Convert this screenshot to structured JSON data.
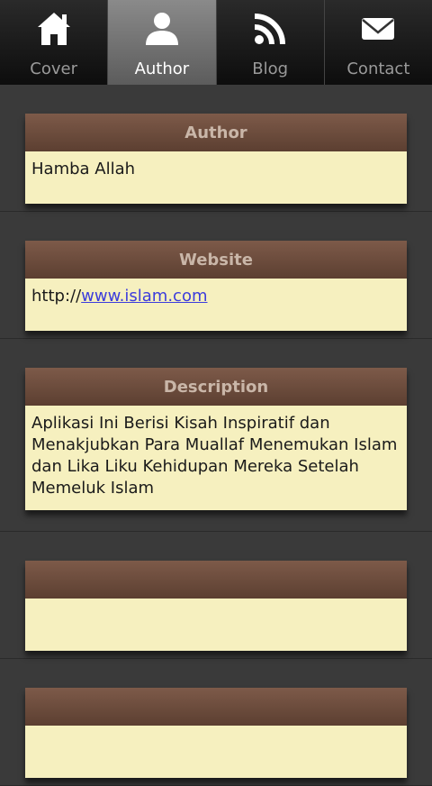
{
  "tabs": [
    {
      "label": "Cover",
      "icon": "home-icon",
      "active": false
    },
    {
      "label": "Author",
      "icon": "person-icon",
      "active": true
    },
    {
      "label": "Blog",
      "icon": "rss-icon",
      "active": false
    },
    {
      "label": "Contact",
      "icon": "mail-icon",
      "active": false
    }
  ],
  "sections": {
    "author": {
      "title": "Author",
      "value": "Hamba Allah"
    },
    "website": {
      "title": "Website",
      "prefix": "http://",
      "link": "www.islam.com"
    },
    "description": {
      "title": "Description",
      "value": "Aplikasi Ini Berisi Kisah Inspiratif dan Menakjubkan Para Muallaf Menemukan Islam dan Lika Liku Kehidupan Mereka Setelah Memeluk Islam"
    },
    "empty1": {
      "title": "",
      "value": ""
    },
    "empty2": {
      "title": "",
      "value": ""
    }
  },
  "colors": {
    "header_brown": "#6b4a3a",
    "body_cream": "#f6f0bf",
    "background": "#3a3a3a",
    "link": "#3c3cdc"
  }
}
